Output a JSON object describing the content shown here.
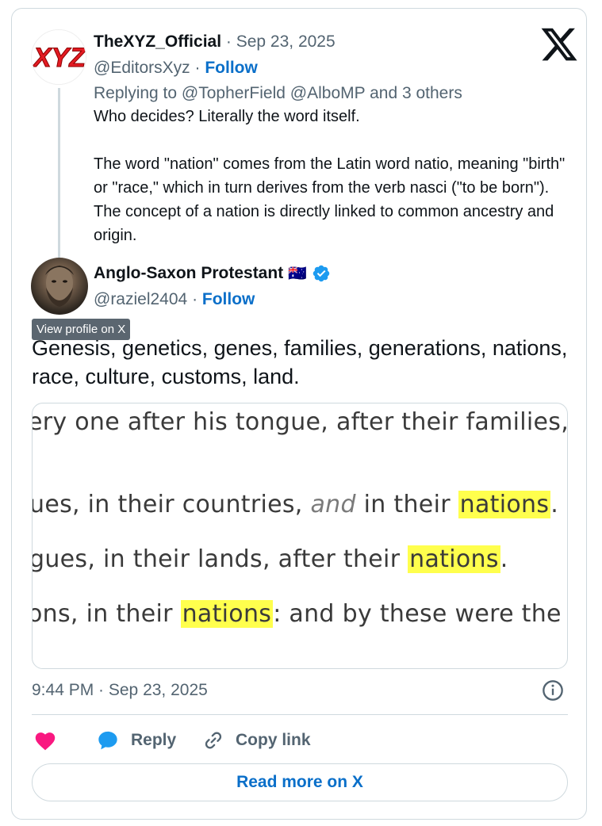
{
  "parent_tweet": {
    "author_name": "TheXYZ_Official",
    "date": "Sep 23, 2025",
    "handle": "@EditorsXyz",
    "follow_label": "Follow",
    "replying_to": "Replying to @TopherField @AlboMP and 3 others",
    "avatar_logo_text": "XYZ",
    "body_paragraphs": [
      "Who decides? Literally the word itself.",
      "The word \"nation\" comes from the Latin word natio, meaning \"birth\" or \"race,\" which in turn derives from the verb nasci (\"to be born\"). The concept of a nation is directly linked to common ancestry and origin."
    ]
  },
  "main_tweet": {
    "author_name": "Anglo-Saxon Protestant",
    "flag": "🇦🇺",
    "verified": true,
    "handle": "@raziel2404",
    "follow_label": "Follow",
    "tooltip": "View profile on X",
    "body": "Genesis, genetics, genes, families, generations, nations, race, culture, customs, land.",
    "image_lines": [
      {
        "before": "ery one after his tongue, after their families,",
        "italic": "",
        "middle": "",
        "highlight": "",
        "after": ""
      },
      {
        "before": "ues, in their countries, ",
        "italic": "and",
        "middle": " in their ",
        "highlight": "nations",
        "after": "."
      },
      {
        "before": "gues, in their lands, after their ",
        "italic": "",
        "middle": "",
        "highlight": "nations",
        "after": "."
      },
      {
        "before": "ons, in their ",
        "italic": "",
        "middle": "",
        "highlight": "nations",
        "after": ": and by these were the"
      }
    ],
    "timestamp": "9:44 PM · Sep 23, 2025"
  },
  "actions": {
    "reply_label": "Reply",
    "copy_link_label": "Copy link",
    "read_more_label": "Read more on X"
  },
  "colors": {
    "link_blue": "#0a6fc9",
    "heart_pink": "#f91880",
    "verified_blue": "#1d9bf0",
    "highlight_yellow": "#ffff4d"
  },
  "icons": [
    "x-logo-icon",
    "verified-badge-icon",
    "info-icon",
    "heart-icon",
    "reply-bubble-icon",
    "link-icon"
  ]
}
